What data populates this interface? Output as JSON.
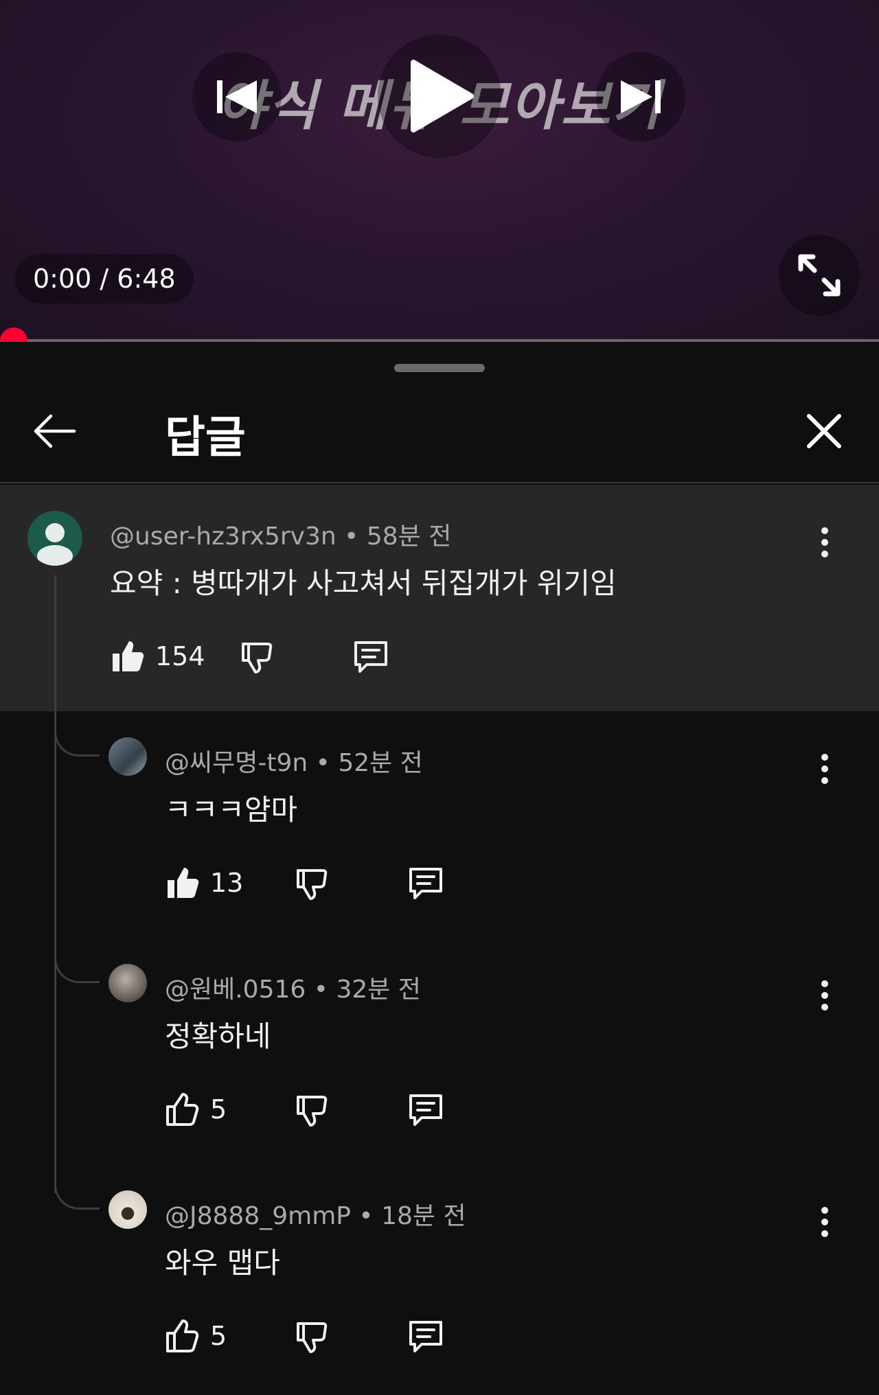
{
  "player": {
    "caption": "야식 메뉴 모아보기",
    "time_display": "0:00 / 6:48",
    "progress": 0,
    "accent_color": "#ff0033"
  },
  "sheet": {
    "title": "답글",
    "icons": {
      "back": "arrow-left-icon",
      "close": "close-icon"
    }
  },
  "parent_comment": {
    "author": "@user-hz3rx5rv3n",
    "age": "58분 전",
    "text": "요약 : 병따개가 사고쳐서 뒤집개가 위기임",
    "likes": "154",
    "liked": true
  },
  "replies": [
    {
      "author": "@씨무명-t9n",
      "age": "52분 전",
      "text": "ㅋㅋㅋ얌마",
      "likes": "13",
      "liked": true
    },
    {
      "author": "@원베.0516",
      "age": "32분 전",
      "text": "정확하네",
      "likes": "5",
      "liked": false
    },
    {
      "author": "@J8888_9mmP",
      "age": "18분 전",
      "text": "와우 맵다",
      "likes": "5",
      "liked": false
    }
  ],
  "separator": " • "
}
